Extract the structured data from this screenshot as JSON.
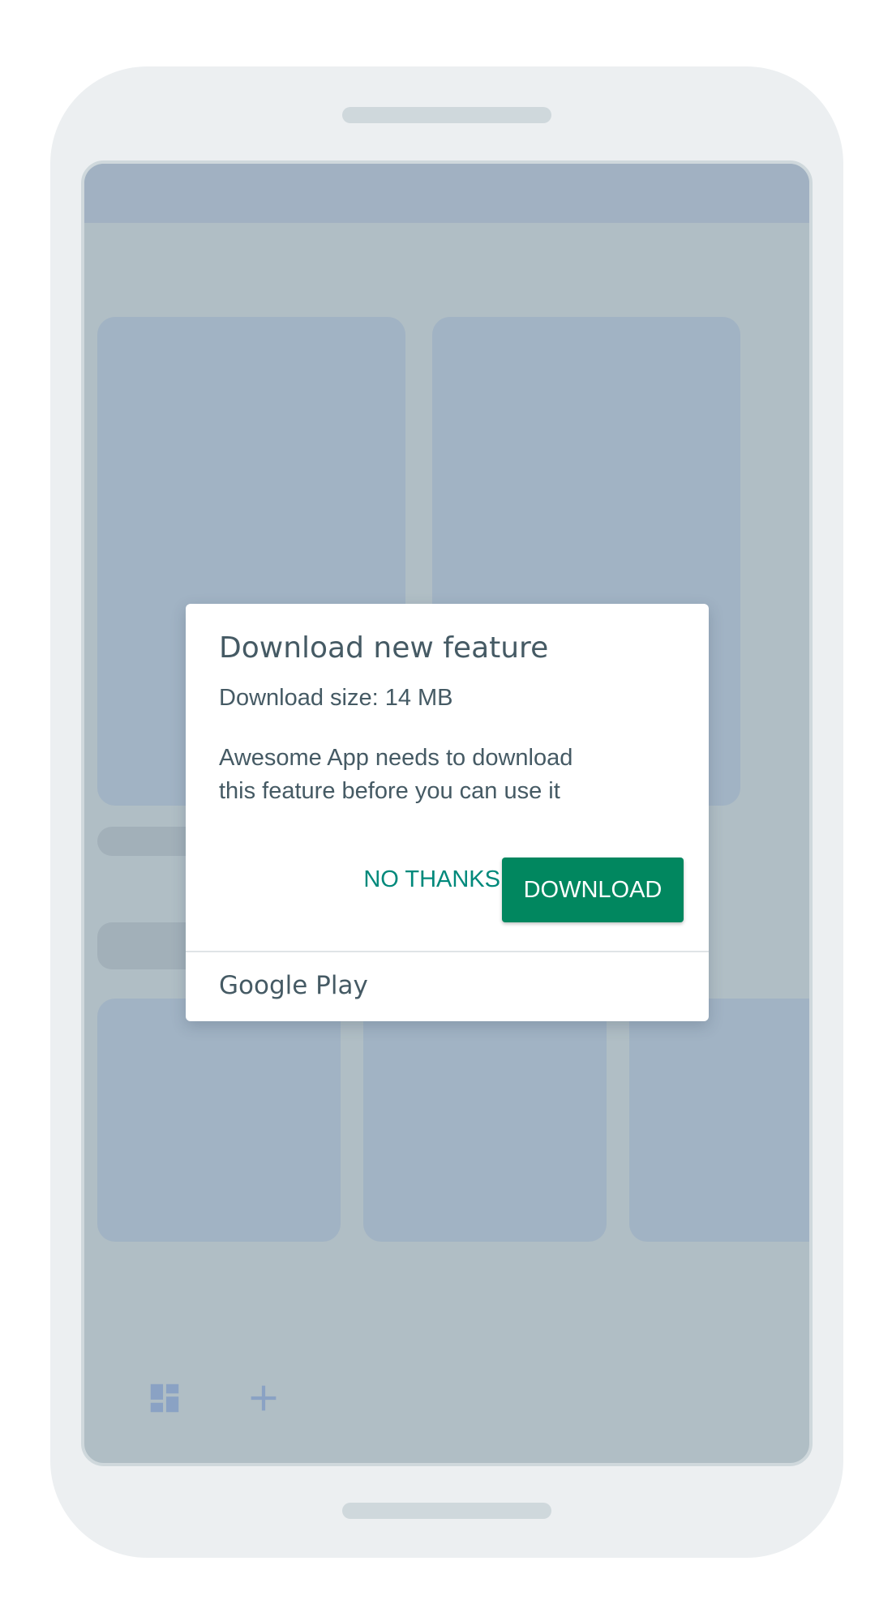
{
  "dialog": {
    "title": "Download new feature",
    "size_text": "Download size: 14 MB",
    "body_line1": "Awesome App needs to download",
    "body_line2": "this feature before you can use it",
    "secondary_button": "NO THANKS",
    "primary_button": "DOWNLOAD",
    "footer_brand": "Google Play"
  },
  "bottom_nav": {
    "icons": [
      "dashboard-icon",
      "add-icon"
    ]
  },
  "colors": {
    "primary_button_bg": "#01875f",
    "secondary_button_text": "#00897b",
    "text": "#455a64",
    "screen_bg": "#b0bec5",
    "placeholder_block": "#a1b3c4",
    "phone_frame": "#eceff1"
  }
}
